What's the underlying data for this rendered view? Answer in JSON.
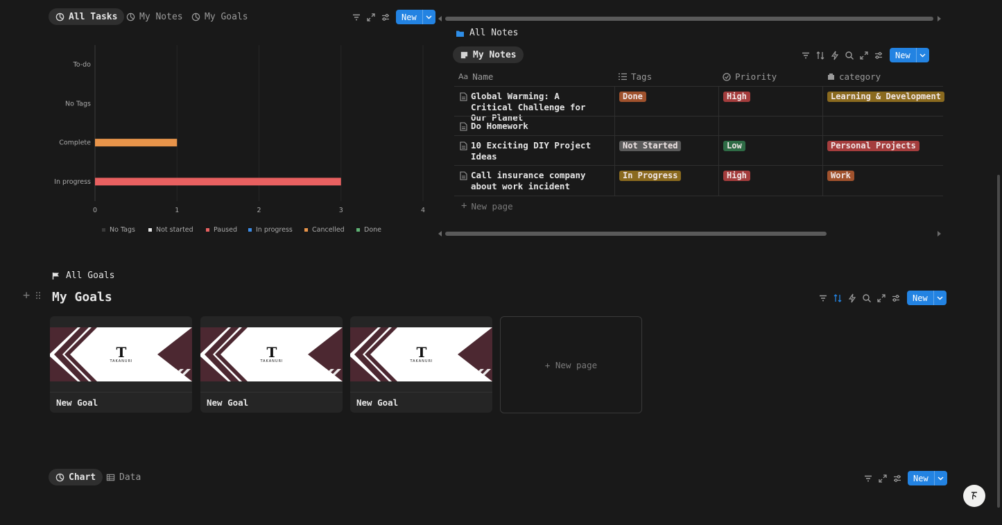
{
  "tasks_view": {
    "tabs": [
      "All Tasks",
      "My Notes",
      "My Goals"
    ],
    "new_label": "New"
  },
  "chart_data": {
    "type": "bar",
    "orientation": "horizontal",
    "categories": [
      "To-do",
      "No Tags",
      "Complete",
      "In progress"
    ],
    "series": [
      {
        "name": "Cancelled",
        "values": [
          0,
          0,
          1,
          0
        ],
        "color": "#e8944a"
      },
      {
        "name": "Paused",
        "values": [
          0,
          0,
          0,
          3
        ],
        "color": "#e86060"
      }
    ],
    "x_ticks": [
      "0",
      "1",
      "2",
      "3",
      "4"
    ],
    "xlim": [
      0,
      4
    ],
    "grid": true,
    "legend": [
      {
        "label": "No Tags",
        "color": "#3a3a3a"
      },
      {
        "label": "Not started",
        "color": "#e6e6e6"
      },
      {
        "label": "Paused",
        "color": "#e86060"
      },
      {
        "label": "In progress",
        "color": "#3c8ce7"
      },
      {
        "label": "Cancelled",
        "color": "#e8944a"
      },
      {
        "label": "Done",
        "color": "#5fb374"
      }
    ],
    "legend_placement": "bottom"
  },
  "notes": {
    "heading": "All Notes",
    "tab": "My Notes",
    "new_label": "New",
    "columns": [
      "Name",
      "Tags",
      "Priority",
      "category"
    ],
    "rows": [
      {
        "name": "Global Warming: A Critical Challenge for Our Planet",
        "tags": "Done",
        "priority": "High",
        "category": "Learning & Development"
      },
      {
        "name": "Do Homework",
        "tags": "",
        "priority": "",
        "category": ""
      },
      {
        "name": "10 Exciting DIY Project Ideas",
        "tags": "Not Started",
        "priority": "Low",
        "category": "Personal Projects"
      },
      {
        "name": "Call insurance company about work incident",
        "tags": "In Progress",
        "priority": "High",
        "category": "Work"
      }
    ],
    "new_page": "New page"
  },
  "goals": {
    "heading": "All Goals",
    "title": "My Goals",
    "new_label": "New",
    "cards": [
      {
        "title": "New Goal",
        "cover_logo": "T",
        "cover_brand": "TAKANURI"
      },
      {
        "title": "New Goal",
        "cover_logo": "T",
        "cover_brand": "TAKANURI"
      },
      {
        "title": "New Goal",
        "cover_logo": "T",
        "cover_brand": "TAKANURI"
      }
    ],
    "new_page": "+ New page"
  },
  "bottom_view": {
    "tabs": [
      "Chart",
      "Data"
    ],
    "new_label": "New"
  },
  "colors": {
    "accent": "#2383e2",
    "tag_orange": "#a0522d",
    "tag_red": "#a43d3d",
    "tag_gray": "#5a5a5a",
    "tag_green": "#2e6b45",
    "tag_yellow": "#8a6a1f",
    "cover_maroon": "#4c2831"
  }
}
